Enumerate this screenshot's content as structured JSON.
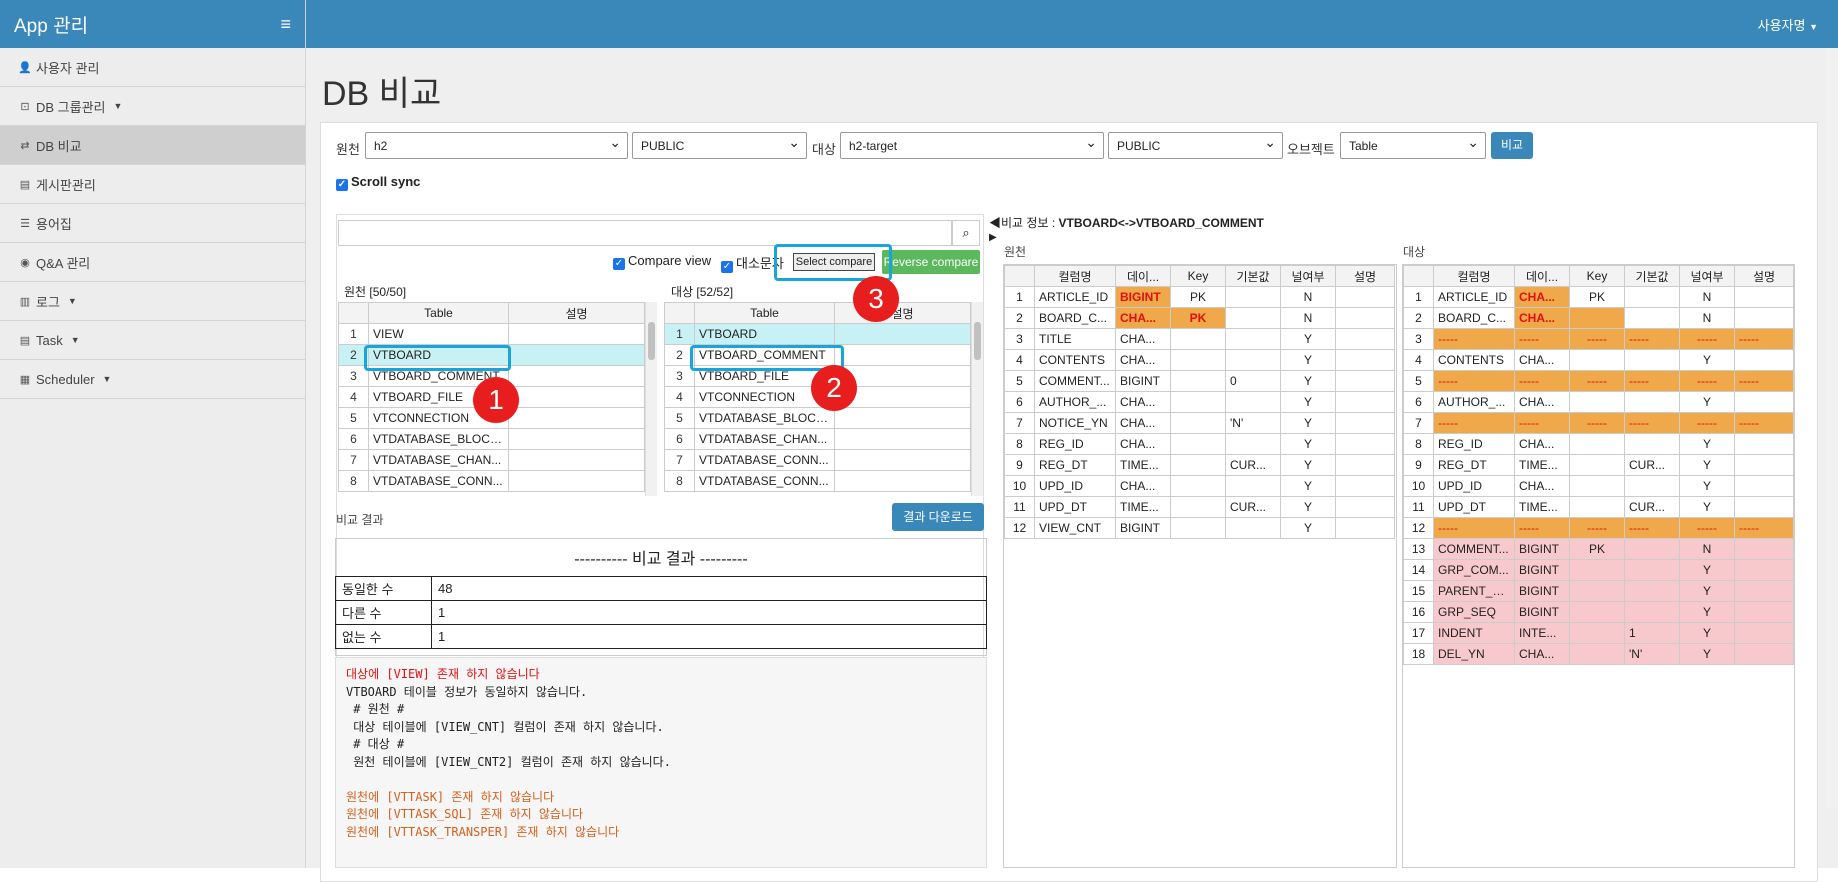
{
  "app": {
    "title": "App 관리",
    "menu_icon": "hamburger-icon",
    "user": "사용자명"
  },
  "sidebar": {
    "items": [
      {
        "label": "사용자 관리",
        "icon": "user-icon"
      },
      {
        "label": "DB 그룹관리",
        "icon": "db-group-icon"
      },
      {
        "label": "DB 비교",
        "icon": "exchange-icon"
      },
      {
        "label": "게시판관리",
        "icon": "board-icon"
      },
      {
        "label": "용어집",
        "icon": "list-icon"
      },
      {
        "label": "Q&A 관리",
        "icon": "eye-icon"
      },
      {
        "label": "로그",
        "icon": "chart-icon"
      },
      {
        "label": "Task",
        "icon": "task-icon"
      },
      {
        "label": "Scheduler",
        "icon": "calendar-icon"
      }
    ]
  },
  "page": {
    "title": "DB 비교"
  },
  "filter": {
    "source_label": "원천",
    "source_db": "h2",
    "source_schema": "PUBLIC",
    "target_label": "대상",
    "target_db": "h2-target",
    "target_schema": "PUBLIC",
    "object_label": "오브젝트",
    "object_type": "Table",
    "compare_btn": "비교",
    "scroll_sync": "Scroll sync"
  },
  "left": {
    "compare_view": "Compare view",
    "case_label": "대소문자",
    "select_compare": "Select compare",
    "reverse_compare": "Reverse compare",
    "source_title": "원천 [50/50]",
    "target_title": "대상 [52/52]",
    "col_table": "Table",
    "col_desc": "설명",
    "source_rows": [
      "VIEW",
      "VTBOARD",
      "VTBOARD_COMMENT",
      "VTBOARD_FILE",
      "VTCONNECTION",
      "VTDATABASE_BLOCK...",
      "VTDATABASE_CHAN...",
      "VTDATABASE_CONN..."
    ],
    "target_rows": [
      "VTBOARD",
      "VTBOARD_COMMENT",
      "VTBOARD_FILE",
      "VTCONNECTION",
      "VTDATABASE_BLOCK...",
      "VTDATABASE_CHAN...",
      "VTDATABASE_CONN...",
      "VTDATABASE_CONN..."
    ]
  },
  "callouts": [
    "1",
    "2",
    "3"
  ],
  "result": {
    "label": "비교 결과",
    "download": "결과 다운로드",
    "heading": "---------- 비교 결과 ---------",
    "rows": [
      [
        "동일한 수",
        "48"
      ],
      [
        "다른 수",
        "1"
      ],
      [
        "없는 수",
        "1"
      ]
    ],
    "log": [
      {
        "t": "대상에 [VIEW] 존재 하지 않습니다",
        "c": "red"
      },
      {
        "t": "VTBOARD 테이블 정보가 동일하지 않습니다.",
        "c": ""
      },
      {
        "t": " # 원천 #",
        "c": ""
      },
      {
        "t": " 대상 테이블에 [VIEW_CNT] 컬럼이 존재 하지 않습니다.",
        "c": ""
      },
      {
        "t": " # 대상 #",
        "c": ""
      },
      {
        "t": " 원천 테이블에 [VIEW_CNT2] 컬럼이 존재 하지 않습니다.",
        "c": ""
      },
      {
        "t": "",
        "c": ""
      },
      {
        "t": "원천에 [VTTASK] 존재 하지 않습니다",
        "c": "org"
      },
      {
        "t": "원천에 [VTTASK_SQL] 존재 하지 않습니다",
        "c": "org"
      },
      {
        "t": "원천에 [VTTASK_TRANSPER] 존재 하지 않습니다",
        "c": "org"
      }
    ]
  },
  "compare": {
    "info_label": "비교 정보 :",
    "info_value": "VTBOARD<->VTBOARD_COMMENT",
    "source_label": "원천",
    "target_label": "대상",
    "headers": [
      "컬럼명",
      "데이...",
      "Key",
      "기본값",
      "널여부",
      "설명"
    ],
    "source_rows": [
      [
        "1",
        "ARTICLE_ID",
        "BIGINT",
        "PK",
        "",
        "N",
        ""
      ],
      [
        "2",
        "BOARD_C...",
        "CHA...",
        "PK",
        "",
        "N",
        ""
      ],
      [
        "3",
        "TITLE",
        "CHA...",
        "",
        "",
        "Y",
        ""
      ],
      [
        "4",
        "CONTENTS",
        "CHA...",
        "",
        "",
        "Y",
        ""
      ],
      [
        "5",
        "COMMENT...",
        "BIGINT",
        "",
        "0",
        "Y",
        ""
      ],
      [
        "6",
        "AUTHOR_...",
        "CHA...",
        "",
        "",
        "Y",
        ""
      ],
      [
        "7",
        "NOTICE_YN",
        "CHA...",
        "",
        "'N'",
        "Y",
        ""
      ],
      [
        "8",
        "REG_ID",
        "CHA...",
        "",
        "",
        "Y",
        ""
      ],
      [
        "9",
        "REG_DT",
        "TIME...",
        "",
        "CUR...",
        "Y",
        ""
      ],
      [
        "10",
        "UPD_ID",
        "CHA...",
        "",
        "",
        "Y",
        ""
      ],
      [
        "11",
        "UPD_DT",
        "TIME...",
        "",
        "CUR...",
        "Y",
        ""
      ],
      [
        "12",
        "VIEW_CNT",
        "BIGINT",
        "",
        "",
        "Y",
        ""
      ]
    ],
    "target_rows": [
      [
        "1",
        "ARTICLE_ID",
        "CHA...",
        "PK",
        "",
        "N",
        ""
      ],
      [
        "2",
        "BOARD_C...",
        "CHA...",
        "",
        "",
        "N",
        ""
      ],
      [
        "3",
        "-----",
        "-----",
        "-----",
        "-----",
        "-----",
        "-----"
      ],
      [
        "4",
        "CONTENTS",
        "CHA...",
        "",
        "",
        "Y",
        ""
      ],
      [
        "5",
        "-----",
        "-----",
        "-----",
        "-----",
        "-----",
        "-----"
      ],
      [
        "6",
        "AUTHOR_...",
        "CHA...",
        "",
        "",
        "Y",
        ""
      ],
      [
        "7",
        "-----",
        "-----",
        "-----",
        "-----",
        "-----",
        "-----"
      ],
      [
        "8",
        "REG_ID",
        "CHA...",
        "",
        "",
        "Y",
        ""
      ],
      [
        "9",
        "REG_DT",
        "TIME...",
        "",
        "CUR...",
        "Y",
        ""
      ],
      [
        "10",
        "UPD_ID",
        "CHA...",
        "",
        "",
        "Y",
        ""
      ],
      [
        "11",
        "UPD_DT",
        "TIME...",
        "",
        "CUR...",
        "Y",
        ""
      ],
      [
        "12",
        "-----",
        "-----",
        "-----",
        "-----",
        "-----",
        "-----"
      ],
      [
        "13",
        "COMMENT...",
        "BIGINT",
        "PK",
        "",
        "N",
        ""
      ],
      [
        "14",
        "GRP_COM...",
        "BIGINT",
        "",
        "",
        "Y",
        ""
      ],
      [
        "15",
        "PARENT_C...",
        "BIGINT",
        "",
        "",
        "Y",
        ""
      ],
      [
        "16",
        "GRP_SEQ",
        "BIGINT",
        "",
        "",
        "Y",
        ""
      ],
      [
        "17",
        "INDENT",
        "INTE...",
        "",
        "1",
        "Y",
        ""
      ],
      [
        "18",
        "DEL_YN",
        "CHA...",
        "",
        "'N'",
        "Y",
        ""
      ]
    ]
  },
  "colors": {
    "accent": "#3a87ba",
    "diff_orange": "#f0a94a",
    "missing_pink": "#f7c9cc",
    "highlight_cyan": "#c8f1f5",
    "green": "#5cb85c"
  }
}
